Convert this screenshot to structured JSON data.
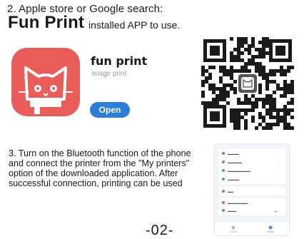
{
  "step2": {
    "text": "2. Apple store or Google search:",
    "brand": "Fun Print",
    "suffix": "installed APP to use."
  },
  "app_listing": {
    "name": "fun print",
    "subtitle": "image print",
    "button": "Open"
  },
  "step3": {
    "text": "3. Turn on the Bluetooth function of the phone and connect the printer from the \"My printers\" option of the downloaded application. After successful connection, printing can be used"
  },
  "page_number": "-02-",
  "colors": {
    "app_icon_bg": "#ea5c57",
    "open_button": "#2c7fd8"
  },
  "icons": [
    "cat-app-icon",
    "qr-code",
    "phone-screenshot"
  ]
}
